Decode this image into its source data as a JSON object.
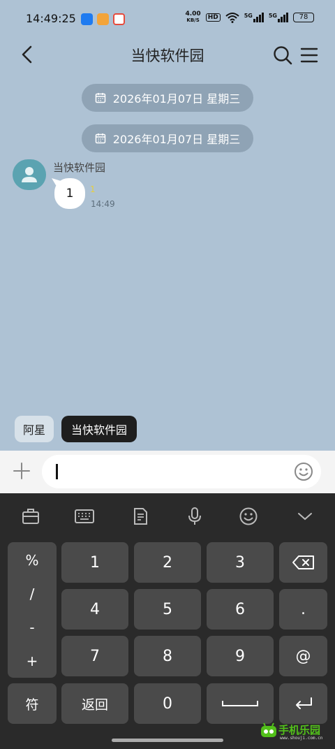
{
  "status_bar": {
    "time": "14:49:25",
    "net_speed_value": "4.00",
    "net_speed_unit": "KB/S",
    "hd_label": "HD",
    "signal1_label": "5G",
    "signal2_label": "5G",
    "battery": "78",
    "app_badge_colors": [
      "#1f7bf0",
      "#f3a43a",
      "#e64a3c"
    ]
  },
  "top_bar": {
    "title": "当快软件园"
  },
  "chat": {
    "date_separators": [
      "2026年01月07日 星期三",
      "2026年01月07日 星期三"
    ],
    "message": {
      "sender": "当快软件园",
      "text": "1",
      "read_mark": "1",
      "time": "14:49"
    }
  },
  "sender_tabs": [
    "阿星",
    "当快软件园"
  ],
  "input": {
    "value": ""
  },
  "keyboard": {
    "symbols": [
      "%",
      "/",
      "-",
      "+"
    ],
    "digits": [
      "1",
      "2",
      "3",
      "4",
      "5",
      "6",
      "7",
      "8",
      "9",
      "0"
    ],
    "dot": ".",
    "at": "@",
    "fu": "符",
    "back": "返回"
  },
  "watermark": {
    "text": "手机乐园",
    "url": "www.shouji.com.cn"
  },
  "colors": {
    "chat_bg": "#aec2d4",
    "date_pill": "#8fa3b5",
    "avatar": "#5ba3b1",
    "keyboard_bg": "#2a2a2a",
    "key_bg": "#4a4a4a"
  }
}
